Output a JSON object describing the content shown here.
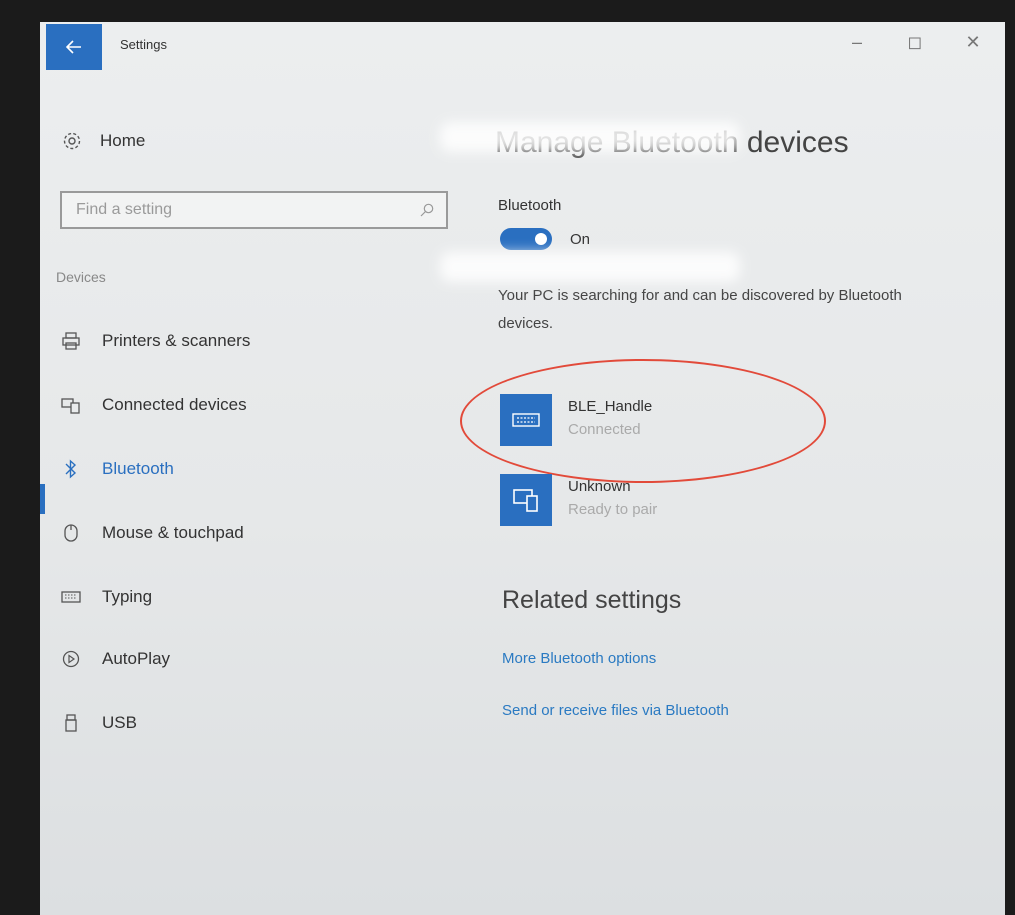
{
  "window": {
    "title": "Settings",
    "controls": {
      "minimize": "–",
      "restore": "◻",
      "close": "✕"
    }
  },
  "nav": {
    "home_label": "Home",
    "search_placeholder": "Find a setting",
    "section_title": "Devices",
    "items": [
      {
        "label": "Printers & scanners",
        "icon": "printer-icon",
        "active": false
      },
      {
        "label": "Connected devices",
        "icon": "connected-devices-icon",
        "active": false
      },
      {
        "label": "Bluetooth",
        "icon": "bluetooth-icon",
        "active": true
      },
      {
        "label": "Mouse & touchpad",
        "icon": "mouse-icon",
        "active": false
      },
      {
        "label": "Typing",
        "icon": "keyboard-icon",
        "active": false
      },
      {
        "label": "AutoPlay",
        "icon": "autoplay-icon",
        "active": false
      },
      {
        "label": "USB",
        "icon": "usb-icon",
        "active": false
      }
    ]
  },
  "main": {
    "title": "Manage Bluetooth devices",
    "bluetooth_label": "Bluetooth",
    "toggle_state": "On",
    "discoverable_text": "Your PC is searching for and can be discovered by Bluetooth devices.",
    "devices": [
      {
        "name": "BLE_Handle",
        "status": "Connected",
        "icon": "keyboard-device-icon",
        "highlighted": true
      },
      {
        "name": "Unknown",
        "status": "Ready to pair",
        "icon": "devices-icon",
        "highlighted": false
      }
    ],
    "related_title": "Related settings",
    "links": [
      "More Bluetooth options",
      "Send or receive files via Bluetooth"
    ]
  },
  "colors": {
    "accent": "#2a6fc0",
    "link": "#2a7ac2",
    "annotation": "#e24a3a"
  }
}
